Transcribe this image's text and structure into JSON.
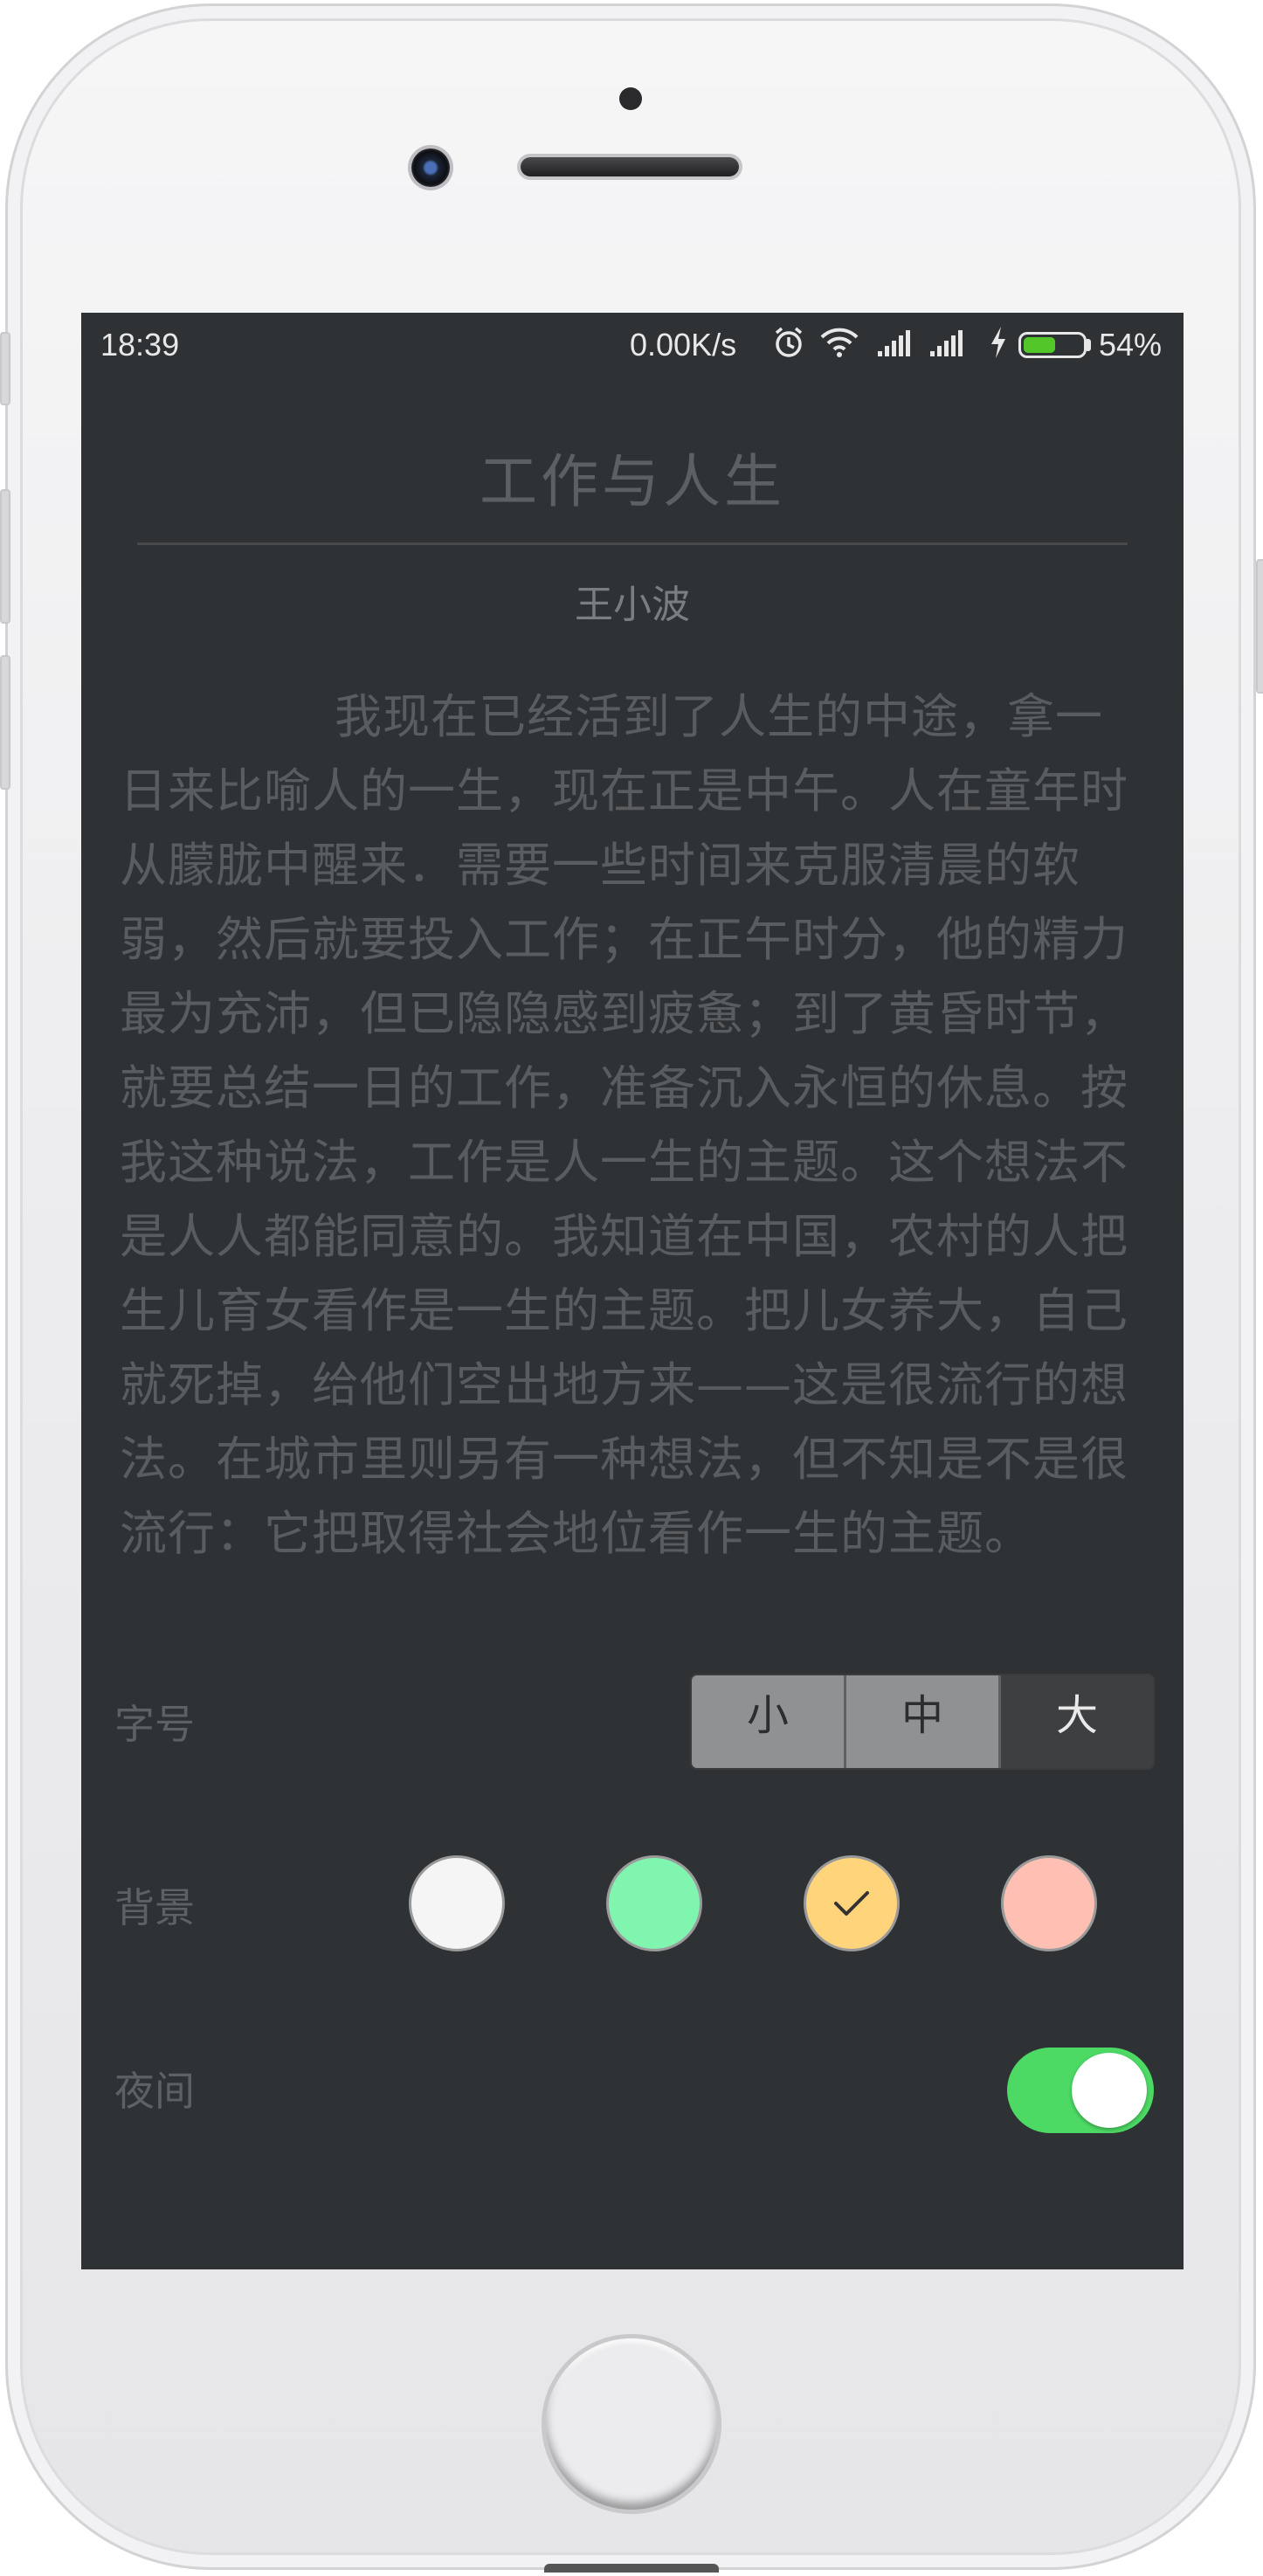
{
  "status_bar": {
    "time": "18:39",
    "net_speed": "0.00K/s",
    "battery_percent": "54%",
    "battery_level": 0.54,
    "icons": [
      "alarm-icon",
      "wifi-icon",
      "signal-icon",
      "signal-icon",
      "charging-icon",
      "battery-icon"
    ]
  },
  "article": {
    "title": "工作与人生",
    "author": "王小波",
    "body": "我现在已经活到了人生的中途，拿一日来比喻人的一生，现在正是中午。人在童年时从朦胧中醒来．需要一些时间来克服清晨的软弱，然后就要投入工作；在正午时分，他的精力最为充沛，但已隐隐感到疲惫；到了黄昏时节，就要总结一日的工作，准备沉入永恒的休息。按我这种说法，工作是人一生的主题。这个想法不是人人都能同意的。我知道在中国，农村的人把生儿育女看作是一生的主题。把儿女养大，自己就死掉，给他们空出地方来——这是很流行的想法。在城市里则另有一种想法，但不知是不是很流行：它把取得社会地位看作一生的主题。"
  },
  "settings": {
    "font_size": {
      "label": "字号",
      "options": [
        "小",
        "中",
        "大"
      ],
      "selected": "大"
    },
    "background": {
      "label": "背景",
      "colors": [
        "#f5f5f5",
        "#7ff5b0",
        "#ffd47a",
        "#ffbfb3"
      ],
      "selected_index": 2
    },
    "night_mode": {
      "label": "夜间",
      "on": true
    }
  },
  "colors": {
    "screen_bg": "#2f3234",
    "toggle_on": "#4cd964",
    "battery_green": "#53c72a"
  }
}
